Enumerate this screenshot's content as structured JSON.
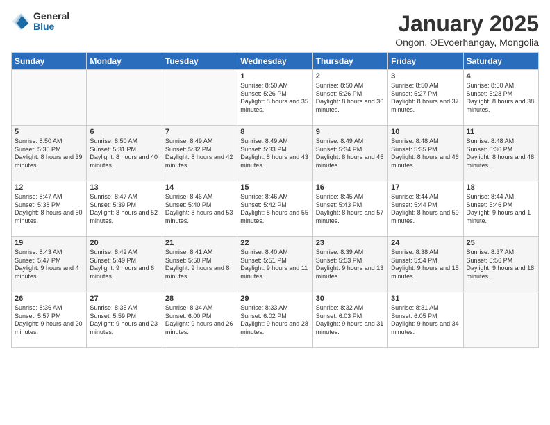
{
  "header": {
    "logo_general": "General",
    "logo_blue": "Blue",
    "main_title": "January 2025",
    "subtitle": "Ongon, OEvoerhangay, Mongolia"
  },
  "calendar": {
    "days_of_week": [
      "Sunday",
      "Monday",
      "Tuesday",
      "Wednesday",
      "Thursday",
      "Friday",
      "Saturday"
    ],
    "weeks": [
      [
        {
          "day": "",
          "content": ""
        },
        {
          "day": "",
          "content": ""
        },
        {
          "day": "",
          "content": ""
        },
        {
          "day": "1",
          "content": "Sunrise: 8:50 AM\nSunset: 5:26 PM\nDaylight: 8 hours and 35 minutes."
        },
        {
          "day": "2",
          "content": "Sunrise: 8:50 AM\nSunset: 5:26 PM\nDaylight: 8 hours and 36 minutes."
        },
        {
          "day": "3",
          "content": "Sunrise: 8:50 AM\nSunset: 5:27 PM\nDaylight: 8 hours and 37 minutes."
        },
        {
          "day": "4",
          "content": "Sunrise: 8:50 AM\nSunset: 5:28 PM\nDaylight: 8 hours and 38 minutes."
        }
      ],
      [
        {
          "day": "5",
          "content": "Sunrise: 8:50 AM\nSunset: 5:30 PM\nDaylight: 8 hours and 39 minutes."
        },
        {
          "day": "6",
          "content": "Sunrise: 8:50 AM\nSunset: 5:31 PM\nDaylight: 8 hours and 40 minutes."
        },
        {
          "day": "7",
          "content": "Sunrise: 8:49 AM\nSunset: 5:32 PM\nDaylight: 8 hours and 42 minutes."
        },
        {
          "day": "8",
          "content": "Sunrise: 8:49 AM\nSunset: 5:33 PM\nDaylight: 8 hours and 43 minutes."
        },
        {
          "day": "9",
          "content": "Sunrise: 8:49 AM\nSunset: 5:34 PM\nDaylight: 8 hours and 45 minutes."
        },
        {
          "day": "10",
          "content": "Sunrise: 8:48 AM\nSunset: 5:35 PM\nDaylight: 8 hours and 46 minutes."
        },
        {
          "day": "11",
          "content": "Sunrise: 8:48 AM\nSunset: 5:36 PM\nDaylight: 8 hours and 48 minutes."
        }
      ],
      [
        {
          "day": "12",
          "content": "Sunrise: 8:47 AM\nSunset: 5:38 PM\nDaylight: 8 hours and 50 minutes."
        },
        {
          "day": "13",
          "content": "Sunrise: 8:47 AM\nSunset: 5:39 PM\nDaylight: 8 hours and 52 minutes."
        },
        {
          "day": "14",
          "content": "Sunrise: 8:46 AM\nSunset: 5:40 PM\nDaylight: 8 hours and 53 minutes."
        },
        {
          "day": "15",
          "content": "Sunrise: 8:46 AM\nSunset: 5:42 PM\nDaylight: 8 hours and 55 minutes."
        },
        {
          "day": "16",
          "content": "Sunrise: 8:45 AM\nSunset: 5:43 PM\nDaylight: 8 hours and 57 minutes."
        },
        {
          "day": "17",
          "content": "Sunrise: 8:44 AM\nSunset: 5:44 PM\nDaylight: 8 hours and 59 minutes."
        },
        {
          "day": "18",
          "content": "Sunrise: 8:44 AM\nSunset: 5:46 PM\nDaylight: 9 hours and 1 minute."
        }
      ],
      [
        {
          "day": "19",
          "content": "Sunrise: 8:43 AM\nSunset: 5:47 PM\nDaylight: 9 hours and 4 minutes."
        },
        {
          "day": "20",
          "content": "Sunrise: 8:42 AM\nSunset: 5:49 PM\nDaylight: 9 hours and 6 minutes."
        },
        {
          "day": "21",
          "content": "Sunrise: 8:41 AM\nSunset: 5:50 PM\nDaylight: 9 hours and 8 minutes."
        },
        {
          "day": "22",
          "content": "Sunrise: 8:40 AM\nSunset: 5:51 PM\nDaylight: 9 hours and 11 minutes."
        },
        {
          "day": "23",
          "content": "Sunrise: 8:39 AM\nSunset: 5:53 PM\nDaylight: 9 hours and 13 minutes."
        },
        {
          "day": "24",
          "content": "Sunrise: 8:38 AM\nSunset: 5:54 PM\nDaylight: 9 hours and 15 minutes."
        },
        {
          "day": "25",
          "content": "Sunrise: 8:37 AM\nSunset: 5:56 PM\nDaylight: 9 hours and 18 minutes."
        }
      ],
      [
        {
          "day": "26",
          "content": "Sunrise: 8:36 AM\nSunset: 5:57 PM\nDaylight: 9 hours and 20 minutes."
        },
        {
          "day": "27",
          "content": "Sunrise: 8:35 AM\nSunset: 5:59 PM\nDaylight: 9 hours and 23 minutes."
        },
        {
          "day": "28",
          "content": "Sunrise: 8:34 AM\nSunset: 6:00 PM\nDaylight: 9 hours and 26 minutes."
        },
        {
          "day": "29",
          "content": "Sunrise: 8:33 AM\nSunset: 6:02 PM\nDaylight: 9 hours and 28 minutes."
        },
        {
          "day": "30",
          "content": "Sunrise: 8:32 AM\nSunset: 6:03 PM\nDaylight: 9 hours and 31 minutes."
        },
        {
          "day": "31",
          "content": "Sunrise: 8:31 AM\nSunset: 6:05 PM\nDaylight: 9 hours and 34 minutes."
        },
        {
          "day": "",
          "content": ""
        }
      ]
    ]
  }
}
